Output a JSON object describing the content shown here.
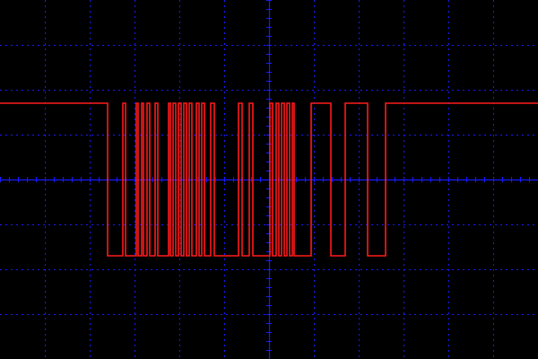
{
  "chart_data": {
    "type": "line",
    "xlim": [
      -6,
      6
    ],
    "ylim": [
      -4,
      4
    ],
    "grid": true,
    "colors": {
      "background": "#000000",
      "grid": "#1a1aff",
      "trace": "#ff1a1a"
    },
    "series": [
      {
        "x": [
          -6,
          -3.6,
          -3.6,
          -3.26,
          -3.26,
          -3.2,
          -3.2,
          -2.96,
          -2.96,
          -2.92,
          -2.92,
          -2.84,
          -2.84,
          -2.8,
          -2.8,
          -2.72,
          -2.72,
          -2.66,
          -2.66,
          -2.54,
          -2.54,
          -2.48,
          -2.48,
          -2.24,
          -2.24,
          -2.2,
          -2.2,
          -2.14,
          -2.14,
          -2.08,
          -2.08,
          -2.02,
          -2.02,
          -1.96,
          -1.96,
          -1.9,
          -1.9,
          -1.84,
          -1.84,
          -1.78,
          -1.78,
          -1.72,
          -1.72,
          -1.62,
          -1.62,
          -1.56,
          -1.56,
          -1.5,
          -1.5,
          -1.44,
          -1.44,
          -1.3,
          -1.3,
          -1.22,
          -1.22,
          -0.68,
          -0.68,
          -0.6,
          -0.6,
          -0.44,
          -0.44,
          -0.36,
          -0.36,
          0.02,
          0.02,
          0.08,
          0.08,
          0.16,
          0.16,
          0.22,
          0.22,
          0.28,
          0.28,
          0.34,
          0.34,
          0.4,
          0.4,
          0.46,
          0.46,
          0.52,
          0.52,
          0.56,
          0.56,
          0.94,
          0.94,
          1.38,
          1.38,
          1.7,
          1.7,
          2.2,
          2.2,
          2.6,
          2.6,
          6
        ],
        "y": [
          1.7,
          1.7,
          -1.7,
          -1.7,
          1.7,
          1.7,
          -1.7,
          -1.7,
          1.7,
          1.7,
          -1.7,
          -1.7,
          1.7,
          1.7,
          -1.7,
          -1.7,
          1.7,
          1.7,
          -1.7,
          -1.7,
          1.7,
          1.7,
          -1.7,
          -1.7,
          1.7,
          1.7,
          -1.7,
          -1.7,
          1.7,
          1.7,
          -1.7,
          -1.7,
          1.7,
          1.7,
          -1.7,
          -1.7,
          1.7,
          1.7,
          -1.7,
          -1.7,
          1.7,
          1.7,
          -1.7,
          -1.7,
          1.7,
          1.7,
          -1.7,
          -1.7,
          1.7,
          1.7,
          -1.7,
          -1.7,
          1.7,
          1.7,
          -1.7,
          -1.7,
          1.7,
          1.7,
          -1.7,
          -1.7,
          1.7,
          1.7,
          -1.7,
          -1.7,
          1.7,
          1.7,
          -1.7,
          -1.7,
          1.7,
          1.7,
          -1.7,
          -1.7,
          1.7,
          1.7,
          -1.7,
          -1.7,
          1.7,
          1.7,
          -1.7,
          -1.7,
          1.7,
          1.7,
          -1.7,
          -1.7,
          1.7,
          1.7,
          -1.7,
          -1.7,
          1.7,
          1.7,
          -1.7,
          -1.7,
          1.7,
          1.7
        ]
      }
    ]
  }
}
